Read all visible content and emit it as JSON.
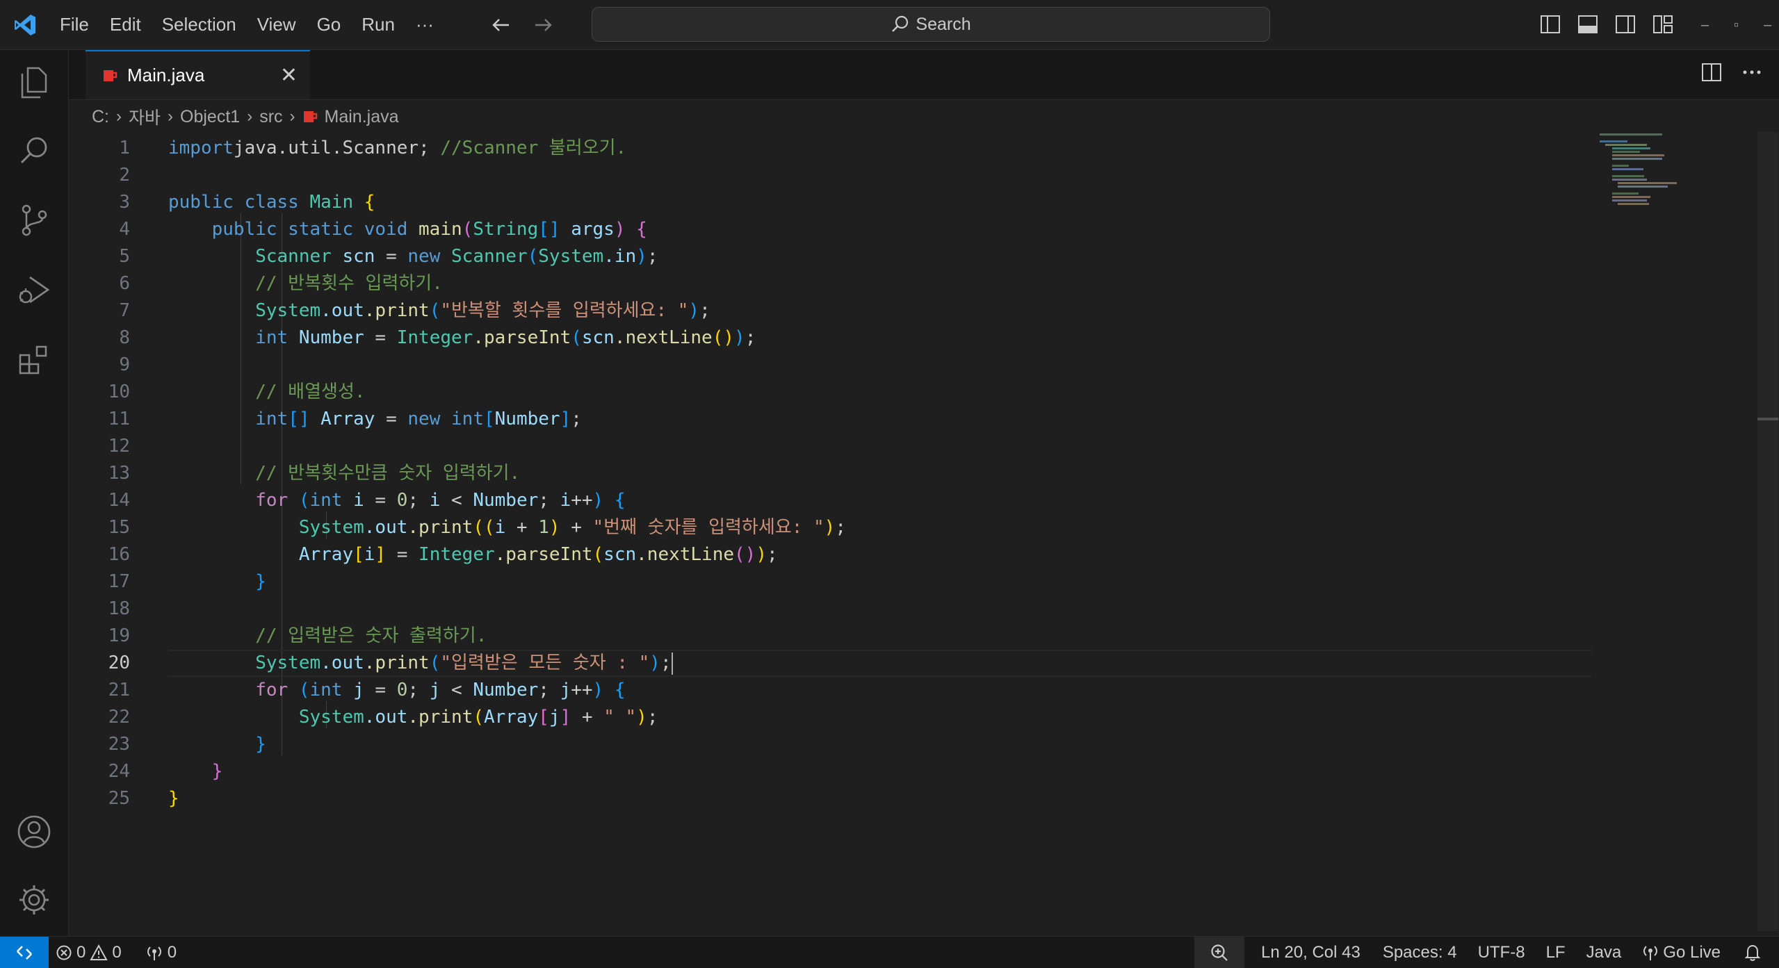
{
  "menu": [
    "File",
    "Edit",
    "Selection",
    "View",
    "Go",
    "Run",
    "···"
  ],
  "search": {
    "label": "Search"
  },
  "window_controls": {
    "minimize": "–",
    "restore": "▫",
    "close": "–"
  },
  "tab": {
    "label": "Main.java",
    "close": "✕"
  },
  "breadcrumb": [
    "C:",
    "자바",
    "Object1",
    "src",
    "Main.java"
  ],
  "editor": {
    "lines": [
      {
        "n": "1",
        "segs": [
          [
            "kw",
            "import"
          ],
          [
            "",
            "java.util.Scanner; "
          ],
          [
            "cm",
            "//Scanner 불러오기."
          ]
        ]
      },
      {
        "n": "2",
        "segs": []
      },
      {
        "n": "3",
        "segs": [
          [
            "kw",
            "public class "
          ],
          [
            "ty",
            "Main"
          ],
          [
            "b1",
            " {"
          ]
        ]
      },
      {
        "n": "4",
        "segs": [
          [
            "kw",
            "    public static void "
          ],
          [
            "fn",
            "main"
          ],
          [
            "b2",
            "("
          ],
          [
            "ty",
            "String"
          ],
          [
            "b3",
            "[]"
          ],
          [
            "var",
            " args"
          ],
          [
            "b2",
            ")"
          ],
          [
            "",
            " "
          ],
          [
            "b2",
            "{"
          ]
        ]
      },
      {
        "n": "5",
        "segs": [
          [
            "ty",
            "        Scanner"
          ],
          [
            "var",
            " scn"
          ],
          [
            "",
            " = "
          ],
          [
            "kw",
            "new "
          ],
          [
            "ty",
            "Scanner"
          ],
          [
            "b3",
            "("
          ],
          [
            "ty",
            "System"
          ],
          [
            "",
            ""
          ],
          [
            "",
            ""
          ],
          [
            "var",
            ".in"
          ],
          [
            "b3",
            ")"
          ],
          [
            "",
            ";"
          ]
        ]
      },
      {
        "n": "6",
        "segs": [
          [
            "cm",
            "        // 반복횟수 입력하기."
          ]
        ]
      },
      {
        "n": "7",
        "segs": [
          [
            "ty",
            "        System"
          ],
          [
            "",
            ""
          ],
          [
            "var",
            ".out"
          ],
          [
            "",
            ""
          ],
          [
            "fn",
            ".print"
          ],
          [
            "b3",
            "("
          ],
          [
            "str",
            "\"반복할 횟수를 입력하세요: \""
          ],
          [
            "b3",
            ")"
          ],
          [
            "",
            ";"
          ]
        ]
      },
      {
        "n": "8",
        "segs": [
          [
            "kw",
            "        int "
          ],
          [
            "var",
            "Number"
          ],
          [
            "",
            " = "
          ],
          [
            "ty",
            "Integer"
          ],
          [
            "fn",
            ".parseInt"
          ],
          [
            "b3",
            "("
          ],
          [
            "var",
            "scn"
          ],
          [
            "fn",
            ".nextLine"
          ],
          [
            "b1",
            "()"
          ],
          [
            "b3",
            ")"
          ],
          [
            "",
            ";"
          ]
        ]
      },
      {
        "n": "9",
        "segs": []
      },
      {
        "n": "10",
        "segs": [
          [
            "cm",
            "        // 배열생성."
          ]
        ]
      },
      {
        "n": "11",
        "segs": [
          [
            "kw",
            "        int"
          ],
          [
            "b3",
            "[]"
          ],
          [
            "var",
            " Array"
          ],
          [
            "",
            " = "
          ],
          [
            "kw",
            "new "
          ],
          [
            "kw",
            "int"
          ],
          [
            "b3",
            "["
          ],
          [
            "var",
            "Number"
          ],
          [
            "b3",
            "]"
          ],
          [
            "",
            ";"
          ]
        ]
      },
      {
        "n": "12",
        "segs": []
      },
      {
        "n": "13",
        "segs": [
          [
            "cm",
            "        // 반복횟수만큼 숫자 입력하기."
          ]
        ]
      },
      {
        "n": "14",
        "segs": [
          [
            "ctl",
            "        for "
          ],
          [
            "b3",
            "("
          ],
          [
            "kw",
            "int "
          ],
          [
            "var",
            "i"
          ],
          [
            "",
            " = "
          ],
          [
            "num",
            "0"
          ],
          [
            "",
            "; "
          ],
          [
            "var",
            "i"
          ],
          [
            "",
            " < "
          ],
          [
            "var",
            "Number"
          ],
          [
            "",
            "; "
          ],
          [
            "var",
            "i"
          ],
          [
            "",
            "++"
          ],
          [
            "b3",
            ")"
          ],
          [
            "b3",
            " {"
          ]
        ]
      },
      {
        "n": "15",
        "segs": [
          [
            "ty",
            "            System"
          ],
          [
            "var",
            ".out"
          ],
          [
            "fn",
            ".print"
          ],
          [
            "b1",
            "(("
          ],
          [
            "var",
            "i"
          ],
          [
            "",
            " + "
          ],
          [
            "num",
            "1"
          ],
          [
            "b1",
            ")"
          ],
          [
            "",
            " + "
          ],
          [
            "str",
            "\"번째 숫자를 입력하세요: \""
          ],
          [
            "b1",
            ")"
          ],
          [
            "",
            ";"
          ]
        ]
      },
      {
        "n": "16",
        "segs": [
          [
            "var",
            "            Array"
          ],
          [
            "b1",
            "["
          ],
          [
            "var",
            "i"
          ],
          [
            "b1",
            "]"
          ],
          [
            "",
            " = "
          ],
          [
            "ty",
            "Integer"
          ],
          [
            "fn",
            ".parseInt"
          ],
          [
            "b1",
            "("
          ],
          [
            "var",
            "scn"
          ],
          [
            "fn",
            ".nextLine"
          ],
          [
            "b2",
            "()"
          ],
          [
            "b1",
            ")"
          ],
          [
            "",
            ";"
          ]
        ]
      },
      {
        "n": "17",
        "segs": [
          [
            "b3",
            "        }"
          ]
        ]
      },
      {
        "n": "18",
        "segs": []
      },
      {
        "n": "19",
        "segs": [
          [
            "cm",
            "        // 입력받은 숫자 출력하기."
          ]
        ]
      },
      {
        "n": "20",
        "segs": [
          [
            "ty",
            "        System"
          ],
          [
            "var",
            ".out"
          ],
          [
            "fn",
            ".print"
          ],
          [
            "b3",
            "("
          ],
          [
            "str",
            "\"입력받은 모든 숫자 : \""
          ],
          [
            "b3",
            ")"
          ],
          [
            "",
            ";"
          ]
        ]
      },
      {
        "n": "21",
        "segs": [
          [
            "ctl",
            "        for "
          ],
          [
            "b3",
            "("
          ],
          [
            "kw",
            "int "
          ],
          [
            "var",
            "j"
          ],
          [
            "",
            " = "
          ],
          [
            "num",
            "0"
          ],
          [
            "",
            "; "
          ],
          [
            "var",
            "j"
          ],
          [
            "",
            " < "
          ],
          [
            "var",
            "Number"
          ],
          [
            "",
            "; "
          ],
          [
            "var",
            "j"
          ],
          [
            "",
            "++"
          ],
          [
            "b3",
            ")"
          ],
          [
            "b3",
            " {"
          ]
        ]
      },
      {
        "n": "22",
        "segs": [
          [
            "ty",
            "            System"
          ],
          [
            "var",
            ".out"
          ],
          [
            "fn",
            ".print"
          ],
          [
            "b1",
            "("
          ],
          [
            "var",
            "Array"
          ],
          [
            "b2",
            "["
          ],
          [
            "var",
            "j"
          ],
          [
            "b2",
            "]"
          ],
          [
            "",
            " + "
          ],
          [
            "str",
            "\" \""
          ],
          [
            "b1",
            ")"
          ],
          [
            "",
            ";"
          ]
        ]
      },
      {
        "n": "23",
        "segs": [
          [
            "b3",
            "        }"
          ]
        ]
      },
      {
        "n": "24",
        "segs": [
          [
            "b2",
            "    }"
          ]
        ]
      },
      {
        "n": "25",
        "segs": [
          [
            "b1",
            "}"
          ]
        ]
      }
    ],
    "active_line": "20"
  },
  "statusbar": {
    "errors": "0",
    "warnings": "0",
    "ports": "0",
    "position": "Ln 20, Col 43",
    "spaces": "Spaces: 4",
    "encoding": "UTF-8",
    "eol": "LF",
    "language": "Java",
    "golive": "Go Live"
  }
}
